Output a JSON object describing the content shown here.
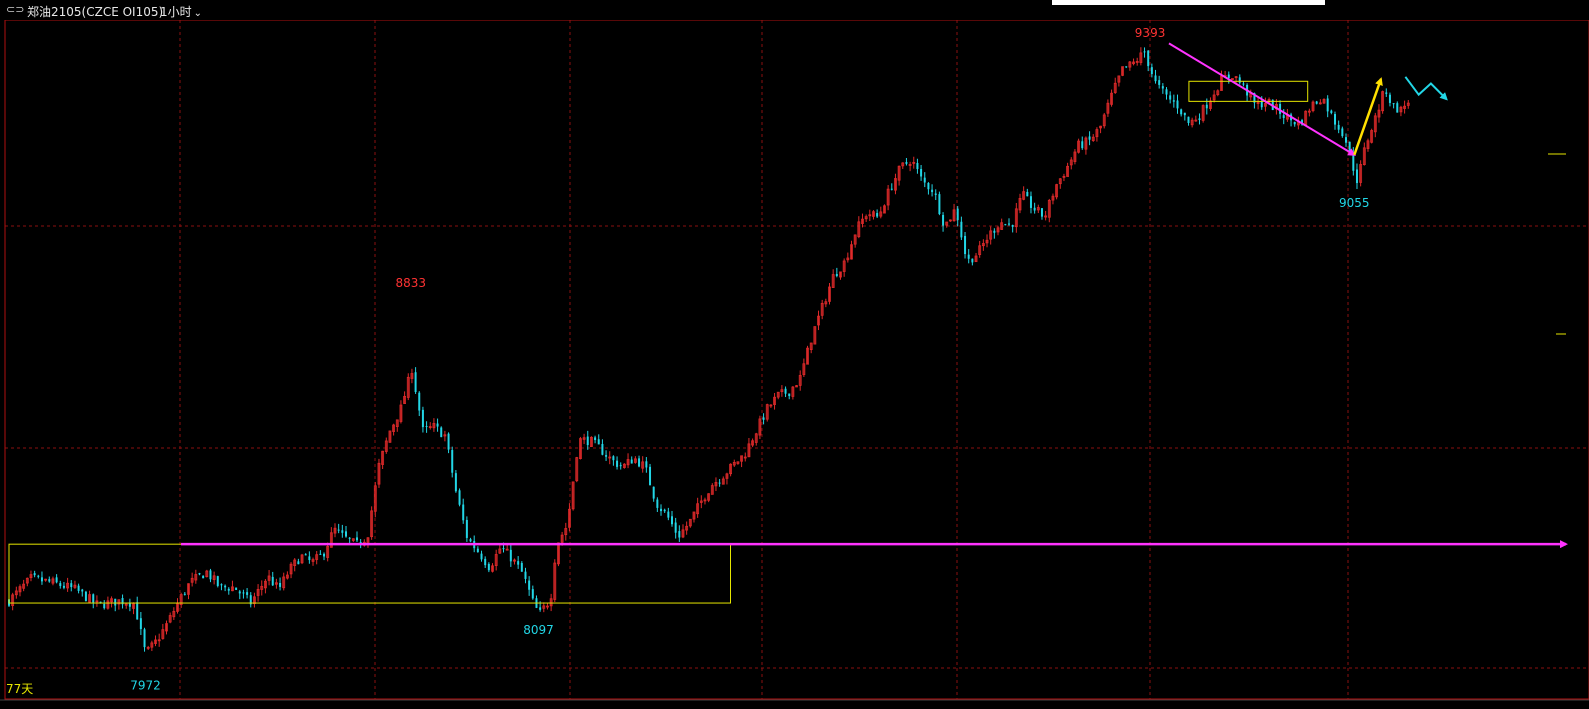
{
  "window": {
    "symbol_icon": "⊂⊃",
    "title": "郑油2105(CZCE OI105)",
    "period": "1小时",
    "period_icon": "chevron-down-icon"
  },
  "colors": {
    "background": "#000000",
    "grid": "#8a1010",
    "frame": "#b01010",
    "up_candle": "#e02a2a",
    "down_candle": "#22d6e6",
    "box": "#e6e600",
    "support_line": "#ff33ff",
    "arrow_yellow": "#ffe000",
    "arrow_cyan": "#22d6e6",
    "high_label": "#ff3333",
    "low_label": "#22d6e6",
    "days_label": "#e6e600"
  },
  "chart_data": {
    "type": "candlestick",
    "instrument": "郑油2105(CZCE OI105)",
    "timeframe": "1小时",
    "days_label": "77天",
    "grid": true,
    "close_path": [
      [
        0,
        8140
      ],
      [
        20,
        8190
      ],
      [
        40,
        8180
      ],
      [
        60,
        8165
      ],
      [
        80,
        8130
      ],
      [
        100,
        8140
      ],
      [
        113,
        8135
      ],
      [
        123,
        8020
      ],
      [
        133,
        8050
      ],
      [
        143,
        8090
      ],
      [
        153,
        8140
      ],
      [
        163,
        8180
      ],
      [
        178,
        8205
      ],
      [
        190,
        8170
      ],
      [
        203,
        8170
      ],
      [
        218,
        8135
      ],
      [
        233,
        8195
      ],
      [
        243,
        8165
      ],
      [
        253,
        8210
      ],
      [
        263,
        8240
      ],
      [
        273,
        8225
      ],
      [
        283,
        8245
      ],
      [
        293,
        8300
      ],
      [
        303,
        8280
      ],
      [
        313,
        8265
      ],
      [
        323,
        8285
      ],
      [
        333,
        8440
      ],
      [
        343,
        8520
      ],
      [
        353,
        8570
      ],
      [
        363,
        8660
      ],
      [
        373,
        8520
      ],
      [
        383,
        8530
      ],
      [
        393,
        8510
      ],
      [
        403,
        8380
      ],
      [
        413,
        8280
      ],
      [
        423,
        8250
      ],
      [
        433,
        8215
      ],
      [
        443,
        8260
      ],
      [
        453,
        8235
      ],
      [
        463,
        8200
      ],
      [
        473,
        8130
      ],
      [
        478,
        8110
      ],
      [
        488,
        8145
      ],
      [
        493,
        8265
      ],
      [
        503,
        8310
      ],
      [
        513,
        8500
      ],
      [
        523,
        8500
      ],
      [
        533,
        8480
      ],
      [
        543,
        8455
      ],
      [
        553,
        8440
      ],
      [
        563,
        8460
      ],
      [
        573,
        8440
      ],
      [
        583,
        8360
      ],
      [
        593,
        8330
      ],
      [
        603,
        8285
      ],
      [
        613,
        8315
      ],
      [
        623,
        8360
      ],
      [
        633,
        8400
      ],
      [
        643,
        8420
      ],
      [
        653,
        8445
      ],
      [
        663,
        8470
      ],
      [
        673,
        8520
      ],
      [
        683,
        8570
      ],
      [
        693,
        8600
      ],
      [
        703,
        8610
      ],
      [
        713,
        8640
      ],
      [
        723,
        8730
      ],
      [
        733,
        8800
      ],
      [
        743,
        8870
      ],
      [
        753,
        8900
      ],
      [
        763,
        8970
      ],
      [
        773,
        9010
      ],
      [
        783,
        9000
      ],
      [
        793,
        9060
      ],
      [
        803,
        9110
      ],
      [
        813,
        9130
      ],
      [
        823,
        9080
      ],
      [
        833,
        9060
      ],
      [
        843,
        8980
      ],
      [
        853,
        9020
      ],
      [
        863,
        8900
      ],
      [
        873,
        8920
      ],
      [
        883,
        8960
      ],
      [
        893,
        8990
      ],
      [
        903,
        8980
      ],
      [
        913,
        9050
      ],
      [
        923,
        9020
      ],
      [
        933,
        9000
      ],
      [
        943,
        9070
      ],
      [
        953,
        9110
      ],
      [
        963,
        9160
      ],
      [
        973,
        9170
      ],
      [
        983,
        9200
      ],
      [
        993,
        9270
      ],
      [
        1003,
        9330
      ],
      [
        1013,
        9345
      ],
      [
        1023,
        9370
      ],
      [
        1033,
        9300
      ],
      [
        1043,
        9270
      ],
      [
        1053,
        9250
      ],
      [
        1063,
        9210
      ],
      [
        1073,
        9230
      ],
      [
        1083,
        9270
      ],
      [
        1093,
        9310
      ],
      [
        1103,
        9320
      ],
      [
        1113,
        9290
      ],
      [
        1123,
        9250
      ],
      [
        1133,
        9260
      ],
      [
        1143,
        9240
      ],
      [
        1153,
        9220
      ],
      [
        1163,
        9210
      ],
      [
        1173,
        9250
      ],
      [
        1183,
        9270
      ],
      [
        1193,
        9220
      ],
      [
        1203,
        9185
      ],
      [
        1210,
        9120
      ],
      [
        1215,
        9080
      ],
      [
        1222,
        9160
      ],
      [
        1232,
        9230
      ],
      [
        1240,
        9290
      ],
      [
        1246,
        9250
      ],
      [
        1254,
        9240
      ],
      [
        1262,
        9265
      ]
    ],
    "annotations": [
      {
        "text": "9393",
        "role": "high",
        "bar": 1028,
        "price": 9393
      },
      {
        "text": "8833",
        "role": "high",
        "bar": 362,
        "price": 8833
      },
      {
        "text": "8097",
        "role": "low",
        "bar": 477,
        "price": 8097
      },
      {
        "text": "7972",
        "role": "low",
        "bar": 123,
        "price": 7972
      },
      {
        "text": "9055",
        "role": "low",
        "bar": 1212,
        "price": 9055
      }
    ],
    "drawings": {
      "range_box": {
        "bar_from": 0,
        "bar_to": 650,
        "price_top": 8267,
        "price_bottom": 8135
      },
      "support_line": {
        "price": 8267,
        "bar_from": 155
      },
      "consolidation_box": {
        "bar_from": 1063,
        "bar_to": 1170,
        "price_top": 9305,
        "price_bottom": 9260
      },
      "arrow_down_magenta": {
        "from": [
          1045,
          9390
        ],
        "to": [
          1212,
          9140
        ]
      },
      "arrow_up_yellow": {
        "from": [
          1212,
          9140
        ],
        "to": [
          1236,
          9310
        ]
      },
      "projection_cyan": [
        [
          1258,
          9315
        ],
        [
          1270,
          9275
        ],
        [
          1281,
          9300
        ],
        [
          1295,
          9265
        ]
      ]
    },
    "price_range": [
      7940,
      9420
    ]
  }
}
